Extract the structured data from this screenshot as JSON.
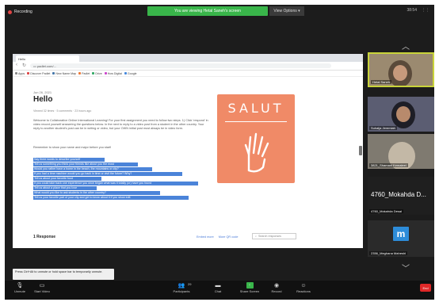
{
  "zoom": {
    "recording_label": "Recording",
    "share_banner": "You are viewing Hetal Saneh's screen",
    "view_options": "View Options ▾",
    "top_right": [
      "38:54",
      "⋮⋮"
    ]
  },
  "browser": {
    "tab_title": "Hello",
    "url": "▭ padlet.com/...",
    "bookmarks": [
      "Apps",
      "Discover Padlet",
      "New Name Map",
      "Padlet",
      "Drive",
      "How Digital",
      "Google"
    ]
  },
  "post": {
    "date": "Jun 26, 2021",
    "title": "Hello",
    "meta": "Viewed 32 times · 5 comments · 23 hours ago",
    "action_label": "Share",
    "paragraph_1": "Welcome to Collaborative Online International Learning! For your first assignment you need to follow two steps. 1) Click 'respond' in video record yourself answering the questions below. In the next to reply to a video post from a student in the other country. Your reply to another student's post can be in writing or video, but your OWN initial post must always be in video form.",
    "paragraph_2": "Remember to show your name and major before you start!",
    "highlighted_lines": [
      "Say three words to describe yourself",
      "Tell us something you think your friends like about you the most",
      "Would you rather have a home in the beach, the mountains or city?",
      "If you had a time machine would you go back in time or visit the future? Why?",
      "Tell us about your favorite food",
      "If you could take back one experience you once began what was it totally (or) have you found",
      "Tell us about a place that you love",
      "What would you like to ask students in the other country?",
      "Tell us your favorite part of your city and get to know about it if you show edit"
    ],
    "card_text": "SALUT",
    "responses_title": "1 Response",
    "responses_links": [
      "Embed more",
      "More QR code"
    ],
    "search_placeholder": "Search responses"
  },
  "participants": {
    "tile_1_name": "Hetal Saneh",
    "tile_2_name": "Suhalja Jeremiah",
    "tile_3_name": "3821_Shamanl Kemaleel",
    "tile_4_big": "4760_Mokahda D...",
    "tile_4_name": "4760_Mokahda Desai",
    "tile_5_initial": "m",
    "tile_5_name": "2356_Meghana Maheshi"
  },
  "tooltip": "Press Ctrl+Alt to unmute or hold space bar to temporarily unmute.",
  "toolbar": {
    "unmute": "Unmute",
    "start_video": "Start Video",
    "participants": "Participants",
    "participants_count": "29",
    "chat": "Chat",
    "share_screen": "Share Screen",
    "record": "Record",
    "reactions": "Reactions",
    "end": "End"
  },
  "colors": {
    "share_banner": "#39b54a",
    "highlight": "#4b84d9",
    "card": "#f08a67",
    "end_button": "#e02828"
  }
}
